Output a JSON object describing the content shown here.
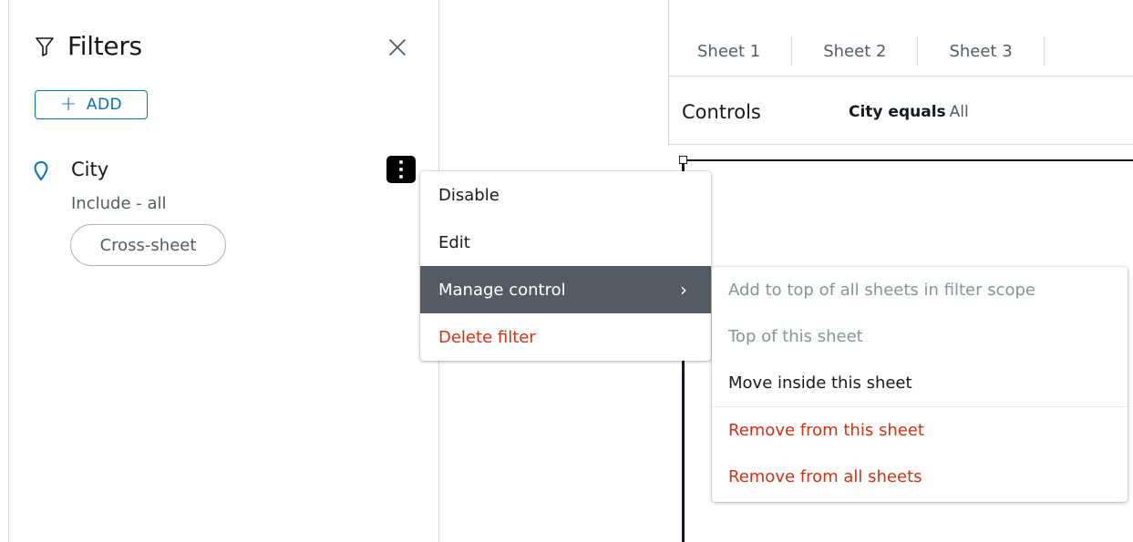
{
  "filters": {
    "title": "Filters",
    "add_label": "ADD",
    "filter_item": {
      "name": "City",
      "description": "Include - all",
      "badge": "Cross-sheet"
    }
  },
  "tabs": [
    "Sheet 1",
    "Sheet 2",
    "Sheet 3"
  ],
  "controls": {
    "label": "Controls",
    "filter_control": {
      "field": "City equals",
      "value": "All"
    }
  },
  "context_menu": {
    "items": [
      "Disable",
      "Edit",
      "Manage control",
      "Delete filter"
    ]
  },
  "submenu": {
    "items": [
      "Add to top of all sheets in filter scope",
      "Top of this sheet",
      "Move inside this sheet",
      "Remove from this sheet",
      "Remove from all sheets"
    ]
  },
  "colors": {
    "accent": "#0073bb",
    "danger": "#d13212",
    "active_menu": "#545b64"
  },
  "icons": [
    "filter-icon",
    "close-icon",
    "plus-icon",
    "location-pin-icon",
    "more-vertical-icon",
    "chevron-right-icon"
  ]
}
